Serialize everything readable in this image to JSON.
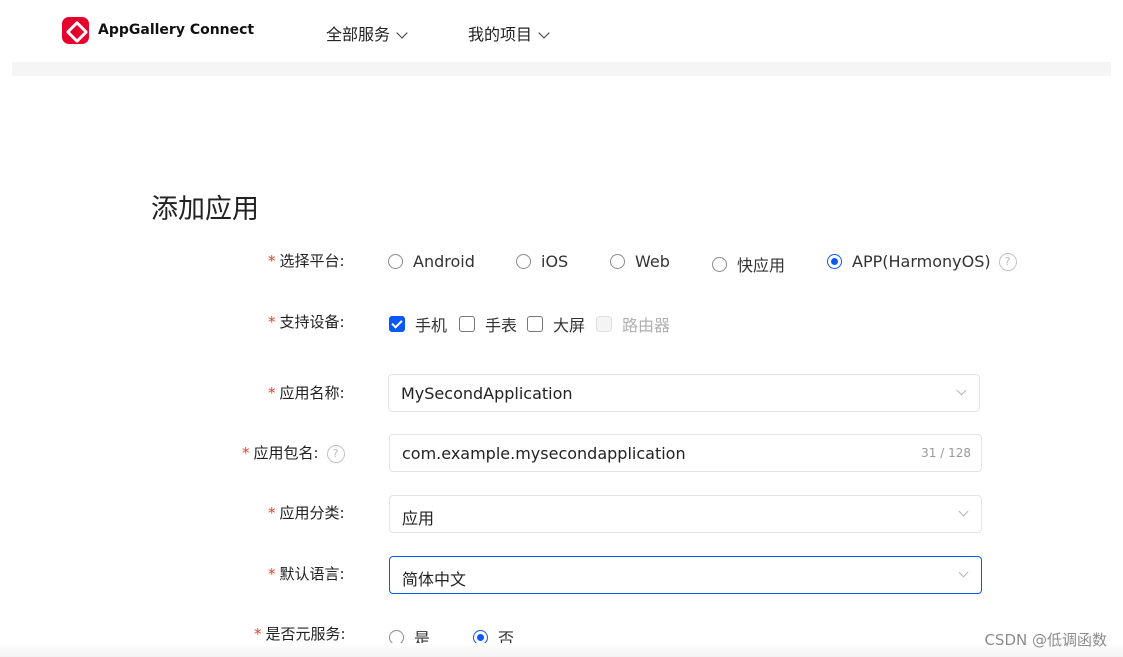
{
  "header": {
    "brand": "AppGallery Connect",
    "nav": [
      {
        "label": "全部服务"
      },
      {
        "label": "我的项目"
      }
    ]
  },
  "page_title": "添加应用",
  "form": {
    "platform": {
      "required_mark": "*",
      "label": "选择平台:",
      "options": [
        {
          "label": "Android",
          "selected": false
        },
        {
          "label": "iOS",
          "selected": false
        },
        {
          "label": "Web",
          "selected": false
        },
        {
          "label": "快应用",
          "selected": false
        },
        {
          "label": "APP(HarmonyOS)",
          "selected": true
        }
      ],
      "help": "?"
    },
    "devices": {
      "required_mark": "*",
      "label": "支持设备:",
      "options": [
        {
          "label": "手机",
          "checked": true,
          "disabled": false
        },
        {
          "label": "手表",
          "checked": false,
          "disabled": false
        },
        {
          "label": "大屏",
          "checked": false,
          "disabled": false
        },
        {
          "label": "路由器",
          "checked": false,
          "disabled": true
        }
      ]
    },
    "app_name": {
      "required_mark": "*",
      "label": "应用名称:",
      "value": "MySecondApplication"
    },
    "package_name": {
      "required_mark": "*",
      "label": "应用包名:",
      "help": "?",
      "value": "com.example.mysecondapplication",
      "counter": "31 / 128"
    },
    "category": {
      "required_mark": "*",
      "label": "应用分类:",
      "value": "应用"
    },
    "language": {
      "required_mark": "*",
      "label": "默认语言:",
      "value": "简体中文"
    },
    "meta_service": {
      "required_mark": "*",
      "label": "是否元服务:",
      "options": [
        {
          "label": "是",
          "selected": false
        },
        {
          "label": "否",
          "selected": true
        }
      ]
    }
  },
  "watermark": "CSDN @低调函数",
  "colors": {
    "accent": "#0a59f7",
    "required": "#e84026",
    "brand": "#e6002c"
  }
}
